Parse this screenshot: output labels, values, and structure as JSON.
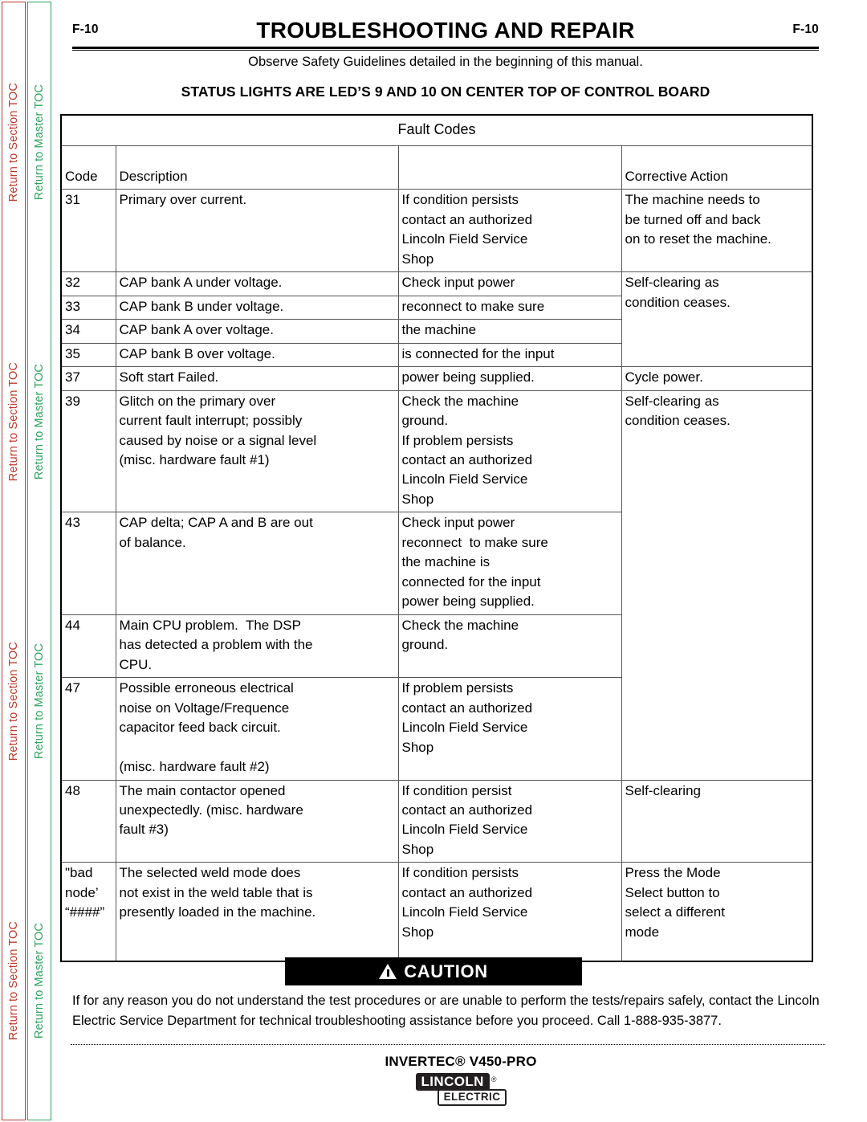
{
  "sidebar": {
    "section_toc_label": "Return to Section TOC",
    "master_toc_label": "Return to Master TOC",
    "section_color": "#c0392b",
    "master_color": "#2fa45e",
    "repeat_count": 4
  },
  "header": {
    "folio_left": "F-10",
    "folio_right": "F-10",
    "title": "TROUBLESHOOTING AND REPAIR",
    "safety_note": "Observe Safety Guidelines detailed in the beginning of this manual.",
    "status_heading": "STATUS LIGHTS ARE LED’S 9 AND 10 ON CENTER TOP OF CONTROL BOARD"
  },
  "table": {
    "title": "Fault Codes",
    "headers": {
      "code": "Code",
      "description": "Description",
      "middle": "",
      "corrective_action": "Corrective Action"
    },
    "rows": [
      {
        "code": "31",
        "description": "Primary over current.",
        "middle": "If condition persists\ncontact an authorized\nLincoln Field Service\nShop",
        "action": "The machine needs to\nbe turned off and back\non to reset the machine."
      },
      {
        "code": "32",
        "description": "CAP bank A under voltage.",
        "middle": "Check input power",
        "action": "Self-clearing as"
      },
      {
        "code": "33",
        "description": "CAP bank B under voltage.",
        "middle": "reconnect to make sure",
        "action": "condition ceases."
      },
      {
        "code": "34",
        "description": "CAP bank A over voltage.",
        "middle": "the machine",
        "action": ""
      },
      {
        "code": "35",
        "description": "CAP bank B over voltage.",
        "middle": "is connected for the input",
        "action": ""
      },
      {
        "code": "37",
        "description": "Soft start Failed.",
        "middle": "power being supplied.",
        "action": "Cycle power."
      },
      {
        "code": "39",
        "description": "Glitch on the primary over\ncurrent fault interrupt; possibly\ncaused by noise or a signal level\n(misc. hardware fault #1)",
        "middle": "Check the machine\nground.\nIf problem persists\ncontact an authorized\nLincoln Field Service\nShop",
        "action": "Self-clearing as\ncondition ceases."
      },
      {
        "code": "43",
        "description": "CAP delta; CAP A and B are out\nof balance.",
        "middle": "Check input power\nreconnect  to make sure\nthe machine is\nconnected for the input\npower being supplied.",
        "action": ""
      },
      {
        "code": "44",
        "description": "Main CPU problem.  The DSP\nhas detected a problem with the\nCPU.",
        "middle": "Check the machine\nground.",
        "action": ""
      },
      {
        "code": "47",
        "description": "Possible erroneous electrical\nnoise on Voltage/Frequence\ncapacitor feed back circuit.\n\n(misc. hardware fault #2)",
        "middle": "If problem persists\ncontact an authorized\nLincoln Field Service\nShop",
        "action": ""
      },
      {
        "code": "48",
        "description": "The main contactor opened\nunexpectedly. (misc. hardware\nfault #3)",
        "middle": "If condition persist\ncontact an authorized\nLincoln Field Service\nShop",
        "action": "Self-clearing"
      },
      {
        "code": "\"bad\nnode’\n“####”",
        "description": "The selected weld mode does\nnot exist in the weld table that is\npresently loaded in the machine.",
        "middle": "If condition persists\ncontact an authorized\nLincoln Field Service\nShop",
        "action": "Press the Mode\nSelect button to\nselect a different\nmode"
      }
    ]
  },
  "caution": {
    "label": "CAUTION",
    "body": "If for any reason you do not understand the test procedures or are unable to perform the tests/repairs safely, contact the Lincoln Electric Service Department for technical troubleshooting assistance before you proceed. Call 1-888-935-3877."
  },
  "footer": {
    "product_name": "INVERTEC® V450-PRO",
    "logo_primary": "LINCOLN",
    "logo_registered": "®",
    "logo_secondary": "ELECTRIC"
  }
}
